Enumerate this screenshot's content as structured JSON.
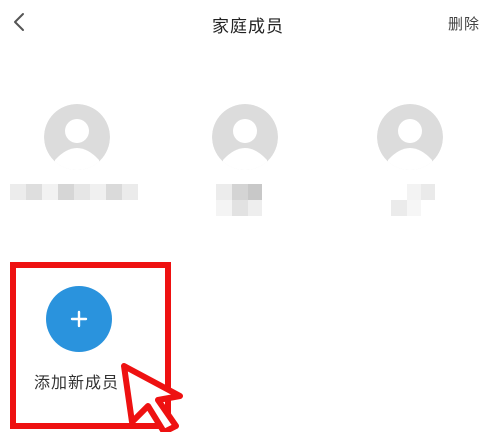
{
  "header": {
    "title": "家庭成员",
    "delete_label": "删除",
    "back_icon": "chevron-left-icon"
  },
  "members": [
    {
      "avatar_icon": "default-avatar-icon",
      "name_state": "pixelated"
    },
    {
      "avatar_icon": "default-avatar-icon",
      "name_state": "pixelated"
    },
    {
      "avatar_icon": "default-avatar-icon",
      "name_state": "pixelated"
    }
  ],
  "add_member": {
    "label": "添加新成员",
    "icon": "plus-icon",
    "accent_color": "#2a93dd"
  },
  "annotation": {
    "highlight_color": "#ee1111",
    "icon": "cursor-arrow-icon"
  },
  "colors": {
    "avatar_bg": "#dcdcdc",
    "avatar_fg": "#ffffff"
  }
}
